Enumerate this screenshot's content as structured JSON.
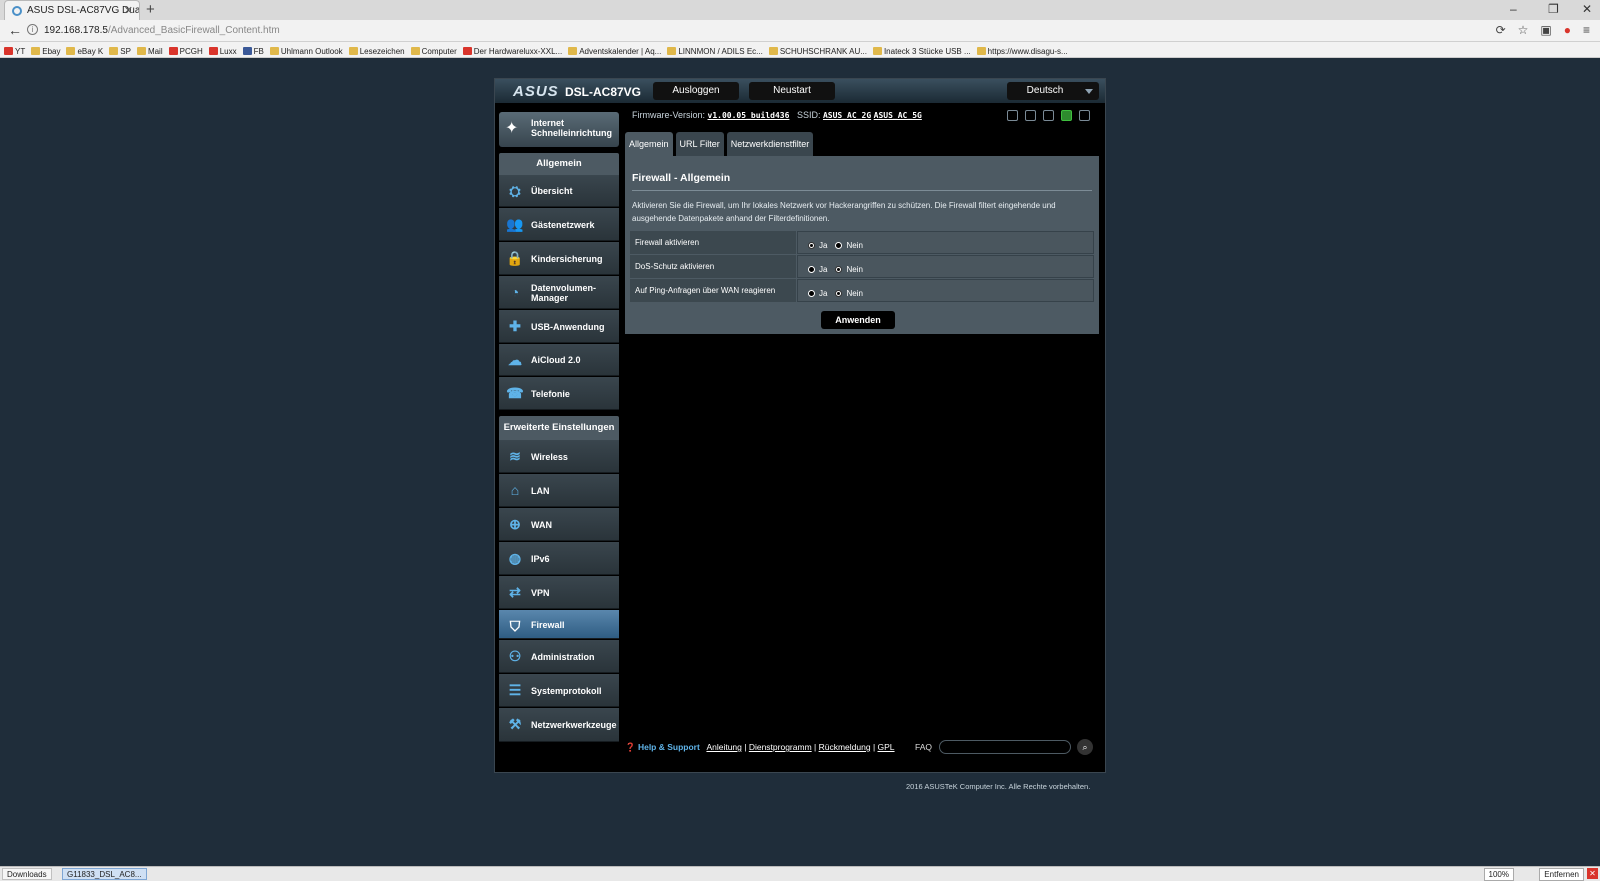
{
  "browser": {
    "tab_title": "ASUS DSL-AC87VG Dual-B...",
    "url_host": "192.168.178.5",
    "url_path": "/Advanced_BasicFirewall_Content.htm",
    "bookmarks": [
      "YT",
      "Ebay",
      "eBay K",
      "SP",
      "Mail",
      "PCGH",
      "Luxx",
      "FB",
      "Uhlmann Outlook",
      "Lesezeichen",
      "Computer",
      "Der Hardwareluxx-XXL...",
      "Adventskalender | Aq...",
      "LINNMON / ADILS Ec...",
      "SCHUHSCHRANK AU...",
      "Inateck 3 Stücke USB ...",
      "https://www.disagu-s..."
    ]
  },
  "header": {
    "logo": "ASUS",
    "model": "DSL-AC87VG",
    "logout": "Ausloggen",
    "reboot": "Neustart",
    "language": "Deutsch"
  },
  "firmware": {
    "label": "Firmware-Version:",
    "version": "v1.00.05_build436",
    "ssid_label": "SSID:",
    "ssid_2g": "ASUS_AC_2G",
    "ssid_5g": "ASUS_AC_5G"
  },
  "sidebar": {
    "qis_label": "Internet Schnelleinrichtung",
    "general_head": "Allgemein",
    "general_items": [
      "Übersicht",
      "Gästenetzwerk",
      "Kindersicherung",
      "Datenvolumen-Manager",
      "USB-Anwendung",
      "AiCloud 2.0",
      "Telefonie"
    ],
    "advanced_head": "Erweiterte Einstellungen",
    "advanced_items": [
      "Wireless",
      "LAN",
      "WAN",
      "IPv6",
      "VPN",
      "Firewall",
      "Administration",
      "Systemprotokoll",
      "Netzwerkwerkzeuge"
    ]
  },
  "tabs": [
    "Allgemein",
    "URL Filter",
    "Netzwerkdienstfilter"
  ],
  "main": {
    "title": "Firewall - Allgemein",
    "description": "Aktivieren Sie die Firewall, um Ihr lokales Netzwerk vor Hackerangriffen zu schützen. Die Firewall filtert eingehende und ausgehende Datenpakete anhand der Filterdefinitionen.",
    "settings": [
      {
        "label": "Firewall aktivieren",
        "yes": "Ja",
        "no": "Nein",
        "selected": "Nein"
      },
      {
        "label": "DoS-Schutz aktivieren",
        "yes": "Ja",
        "no": "Nein",
        "selected": "Ja"
      },
      {
        "label": "Auf Ping-Anfragen über WAN reagieren",
        "yes": "Ja",
        "no": "Nein",
        "selected": "Ja"
      }
    ],
    "apply": "Anwenden"
  },
  "footer": {
    "help": "Help & Support",
    "links": [
      "Anleitung",
      "Dienstprogramm",
      "Rückmeldung",
      "GPL"
    ],
    "faq": "FAQ",
    "copyright": "2016 ASUSTeK Computer Inc. Alle Rechte vorbehalten."
  },
  "downloadbar": {
    "downloads": "Downloads",
    "file": "G11833_DSL_AC8...",
    "zoom": "100%",
    "remove": "Entfernen"
  },
  "colors": {
    "accent": "#5fb3e8",
    "active_item": "#4a7aa3",
    "page_bg": "#1f2d3a"
  }
}
